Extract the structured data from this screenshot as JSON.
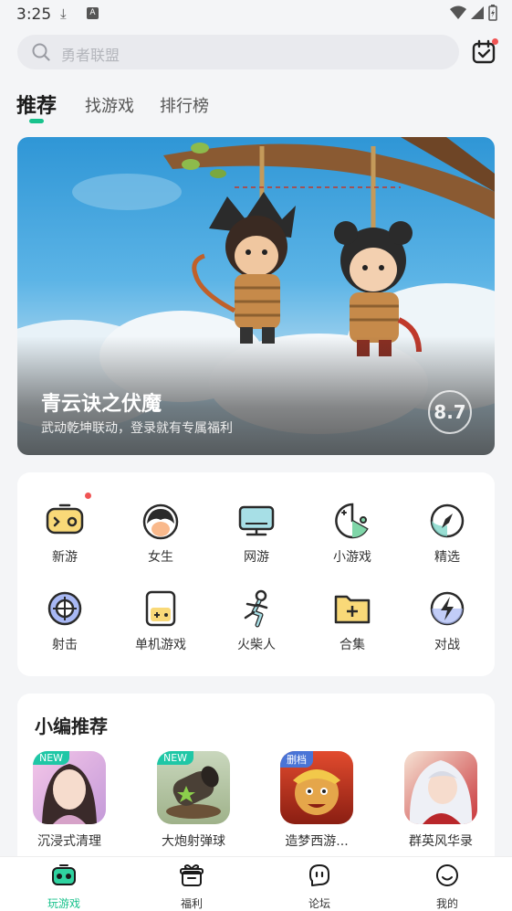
{
  "status_bar": {
    "time": "3:25",
    "badge": "A"
  },
  "search": {
    "placeholder": "勇者联盟"
  },
  "tabs": [
    {
      "label": "推荐",
      "active": true
    },
    {
      "label": "找游戏",
      "active": false
    },
    {
      "label": "排行榜",
      "active": false
    }
  ],
  "banner": {
    "title": "青云诀之伏魔",
    "subtitle": "武动乾坤联动，登录就有专属福利",
    "score": "8.7"
  },
  "categories": [
    {
      "label": "新游",
      "icon": "gamepad-icon"
    },
    {
      "label": "女生",
      "icon": "girl-face-icon"
    },
    {
      "label": "网游",
      "icon": "monitor-icon"
    },
    {
      "label": "小游戏",
      "icon": "pacman-icon"
    },
    {
      "label": "精选",
      "icon": "compass-icon"
    },
    {
      "label": "射击",
      "icon": "crosshair-icon"
    },
    {
      "label": "单机游戏",
      "icon": "handheld-icon"
    },
    {
      "label": "火柴人",
      "icon": "stickman-icon"
    },
    {
      "label": "合集",
      "icon": "folder-plus-icon"
    },
    {
      "label": "对战",
      "icon": "lightning-icon"
    }
  ],
  "picks": {
    "title": "小编推荐",
    "games": [
      {
        "name": "沉浸式清理",
        "tag": "NEW",
        "tag_color": "#1fc7a6"
      },
      {
        "name": "大炮射弹球",
        "tag": "NEW",
        "tag_color": "#1fc7a6"
      },
      {
        "name": "造梦西游...",
        "tag": "删档",
        "tag_color": "#4a74d6"
      },
      {
        "name": "群英风华录",
        "tag": "",
        "tag_color": ""
      }
    ]
  },
  "nav": [
    {
      "label": "玩游戏",
      "icon": "gamepad-nav-icon",
      "active": true
    },
    {
      "label": "福利",
      "icon": "gift-icon",
      "active": false
    },
    {
      "label": "论坛",
      "icon": "chat-bubble-icon",
      "active": false
    },
    {
      "label": "我的",
      "icon": "smiley-icon",
      "active": false
    }
  ],
  "colors": {
    "accent": "#18c28c",
    "badge_red": "#f05454"
  }
}
